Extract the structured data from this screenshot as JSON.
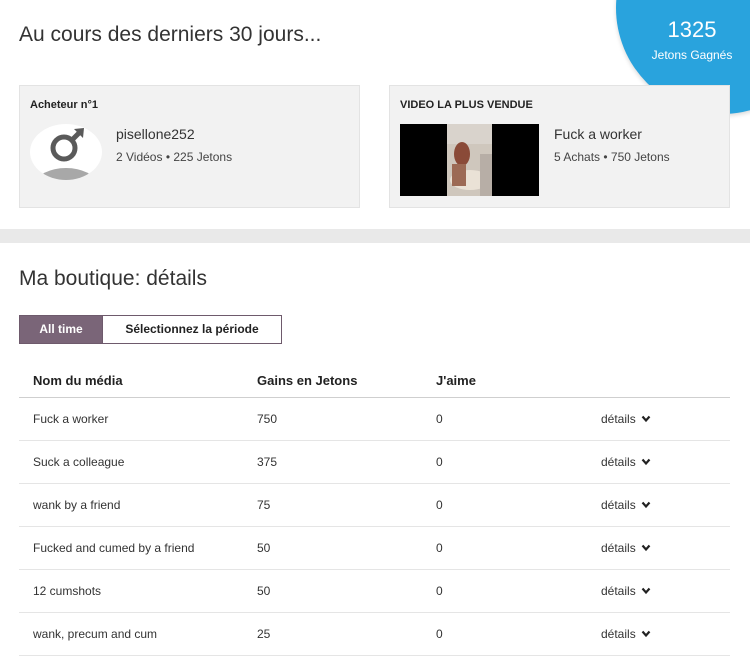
{
  "header": {
    "headline": "Au cours des derniers 30 jours...",
    "tokens_earned": "1325",
    "tokens_earned_label": "Jetons Gagnés",
    "accent_color": "#29a3dd"
  },
  "top_buyer": {
    "title": "Acheteur n°1",
    "name": "pisellone252",
    "meta": "2 Vidéos • 225 Jetons",
    "icon": "male-avatar-icon"
  },
  "top_video": {
    "title": "VIDEO LA PLUS VENDUE",
    "name": "Fuck a worker",
    "meta": "5 Achats • 750 Jetons"
  },
  "shop": {
    "title": "Ma boutique: détails",
    "filters": {
      "all_time": "All time",
      "select_period": "Sélectionnez la période"
    },
    "columns": {
      "name": "Nom du média",
      "earnings": "Gains en Jetons",
      "likes": "J'aime"
    },
    "details_label": "détails",
    "rows": [
      {
        "name": "Fuck a worker",
        "earnings": "750",
        "likes": "0"
      },
      {
        "name": "Suck a colleague",
        "earnings": "375",
        "likes": "0"
      },
      {
        "name": "wank by a friend",
        "earnings": "75",
        "likes": "0"
      },
      {
        "name": "Fucked and cumed by a friend",
        "earnings": "50",
        "likes": "0"
      },
      {
        "name": "12 cumshots",
        "earnings": "50",
        "likes": "0"
      },
      {
        "name": "wank, precum and cum",
        "earnings": "25",
        "likes": "0"
      }
    ]
  }
}
